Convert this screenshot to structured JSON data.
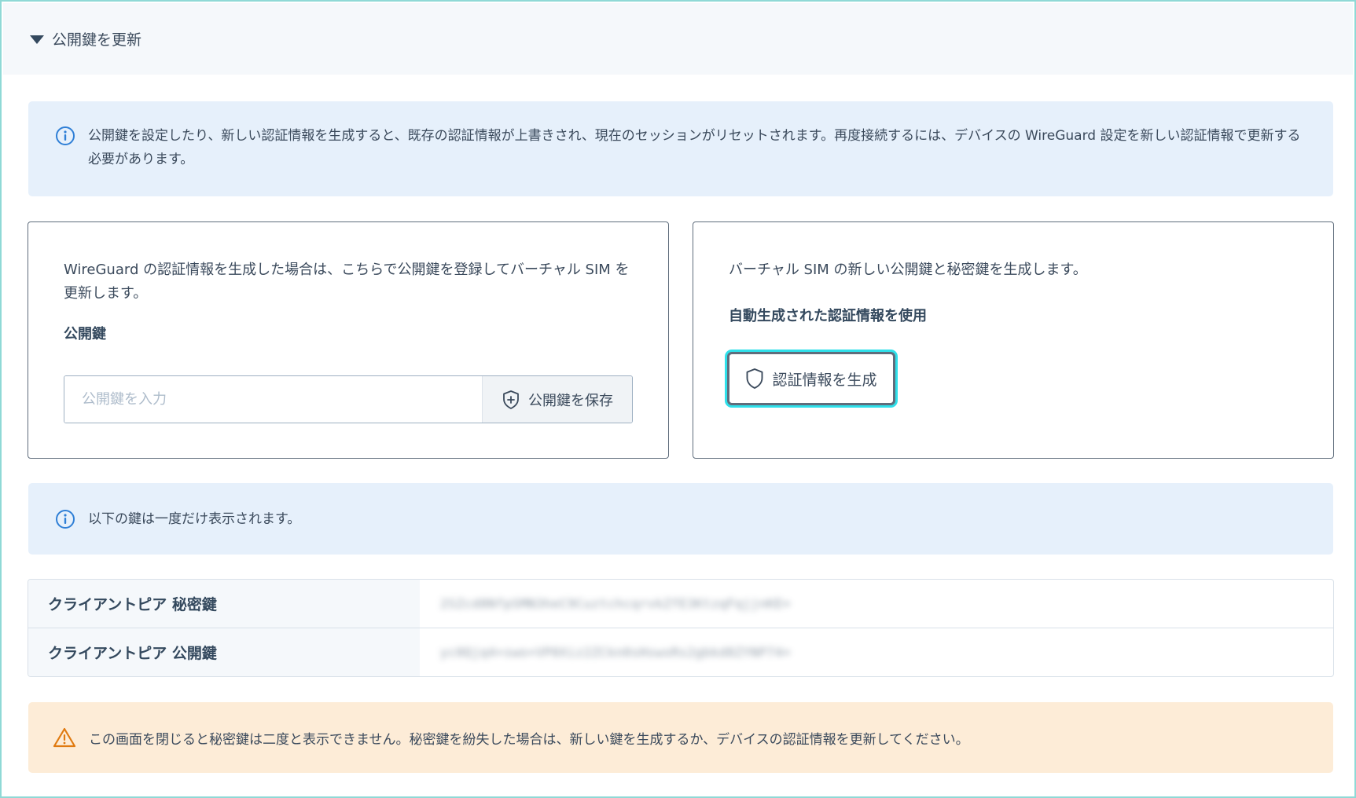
{
  "section": {
    "title": "公開鍵を更新"
  },
  "notice_top": {
    "text": "公開鍵を設定したり、新しい認証情報を生成すると、既存の認証情報が上書きされ、現在のセッションがリセットされます。再度接続するには、デバイスの WireGuard 設定を新しい認証情報で更新する必要があります。"
  },
  "card_public_key": {
    "description": "WireGuard の認証情報を生成した場合は、こちらで公開鍵を登録してバーチャル SIM を更新します。",
    "label": "公開鍵",
    "input_placeholder": "公開鍵を入力",
    "input_value": "",
    "save_button": "公開鍵を保存"
  },
  "card_generate": {
    "description": "バーチャル SIM の新しい公開鍵と秘密鍵を生成します。",
    "label": "自動生成された認証情報を使用",
    "generate_button": "認証情報を生成"
  },
  "notice_keys": {
    "text": "以下の鍵は一度だけ表示されます。"
  },
  "keys": [
    {
      "label": "クライアントピア 秘密鍵",
      "value": "2SZcd8NfpSMN3heC9CuztchcqrvkZfE3KtzqFqjjnKE="
    },
    {
      "label": "クライアントピア 公開鍵",
      "value": "yc0Qjq4+swo+VP0Xiz2ZCkn0sHswxRs2gbkd8ZYNP74="
    }
  ],
  "warning": {
    "text": "この画面を閉じると秘密鍵は二度と表示できません。秘密鍵を紛失した場合は、新しい鍵を生成するか、デバイスの認証情報を更新してください。"
  },
  "icons": {
    "section_toggle": "caret-down-icon",
    "info": "info-circle-icon",
    "save": "shield-plus-icon",
    "generate": "shield-icon",
    "warning": "warning-triangle-icon"
  },
  "colors": {
    "info_bg": "#e6f0fb",
    "info_icon": "#2f7fd6",
    "warning_bg": "#fdecd7",
    "warning_icon": "#e07a10",
    "focus_ring": "#2fe0ea",
    "frame_border": "#8fd9d6"
  }
}
